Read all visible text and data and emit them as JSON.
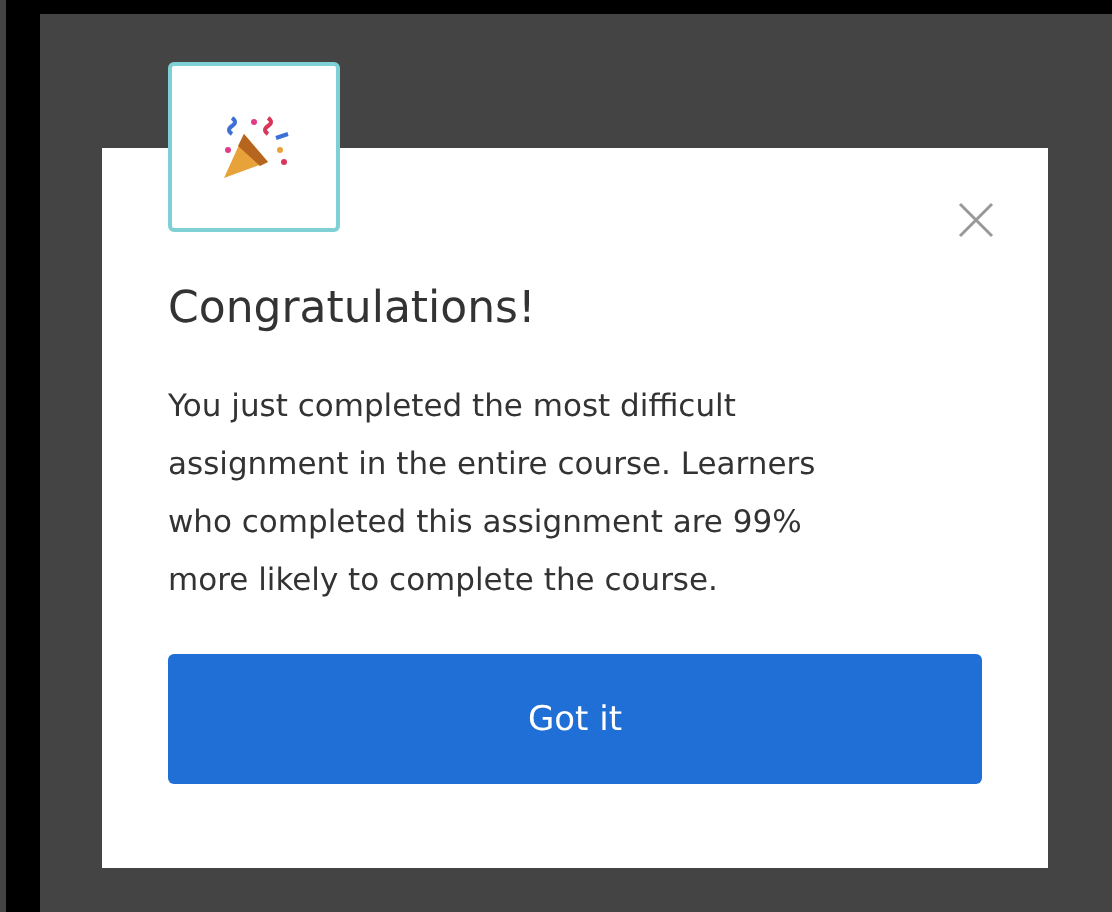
{
  "dialog": {
    "title": "Congratulations!",
    "message": "You just completed the most difficult assignment in the entire course. Learners who completed this assignment are 99% more likely to complete the course.",
    "button": "Got it"
  }
}
